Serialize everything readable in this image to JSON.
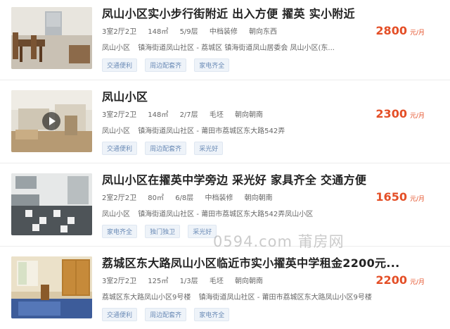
{
  "listings": [
    {
      "title": "凤山小区实小步行街附近 出入方便 擢英 实小附近",
      "layout": "3室2厅2卫",
      "area": "148㎡",
      "floor": "5/9层",
      "decoration": "中档装修",
      "orientation": "朝向东西",
      "address": [
        "凤山小区",
        "镇海街道凤山社区 - 荔城区 镇海街道凤山居委会 凤山小区(东..."
      ],
      "tags": [
        "交通便利",
        "周边配套齐",
        "家电齐全"
      ],
      "price": "2800",
      "unit": "元/月",
      "has_video": false
    },
    {
      "title": "凤山小区",
      "layout": "3室2厅2卫",
      "area": "148㎡",
      "floor": "2/7层",
      "decoration": "毛坯",
      "orientation": "朝向朝南",
      "address": [
        "凤山小区",
        "镇海街道凤山社区 - 莆田市荔城区东大路542弄"
      ],
      "tags": [
        "交通便利",
        "周边配套齐",
        "采光好"
      ],
      "price": "2300",
      "unit": "元/月",
      "has_video": true
    },
    {
      "title": "凤山小区在擢英中学旁边 采光好 家具齐全 交通方便",
      "layout": "2室2厅2卫",
      "area": "80㎡",
      "floor": "6/8层",
      "decoration": "中档装修",
      "orientation": "朝向朝南",
      "address": [
        "凤山小区",
        "镇海街道凤山社区 - 莆田市荔城区东大路542弄凤山小区"
      ],
      "tags": [
        "家电齐全",
        "独门独卫",
        "采光好"
      ],
      "price": "1650",
      "unit": "元/月",
      "has_video": false
    },
    {
      "title": "荔城区东大路凤山小区临近市实小擢英中学租金2200元...",
      "layout": "3室2厅2卫",
      "area": "125㎡",
      "floor": "1/3层",
      "decoration": "毛坯",
      "orientation": "朝向朝南",
      "address": [
        "荔城区东大路凤山小区9号楼",
        "镇海街道凤山社区 - 莆田市荔城区东大路凤山小区9号楼"
      ],
      "tags": [
        "交通便利",
        "周边配套齐",
        "家电齐全"
      ],
      "price": "2200",
      "unit": "元/月",
      "has_video": false
    }
  ],
  "watermark": "0594.com 莆房网"
}
